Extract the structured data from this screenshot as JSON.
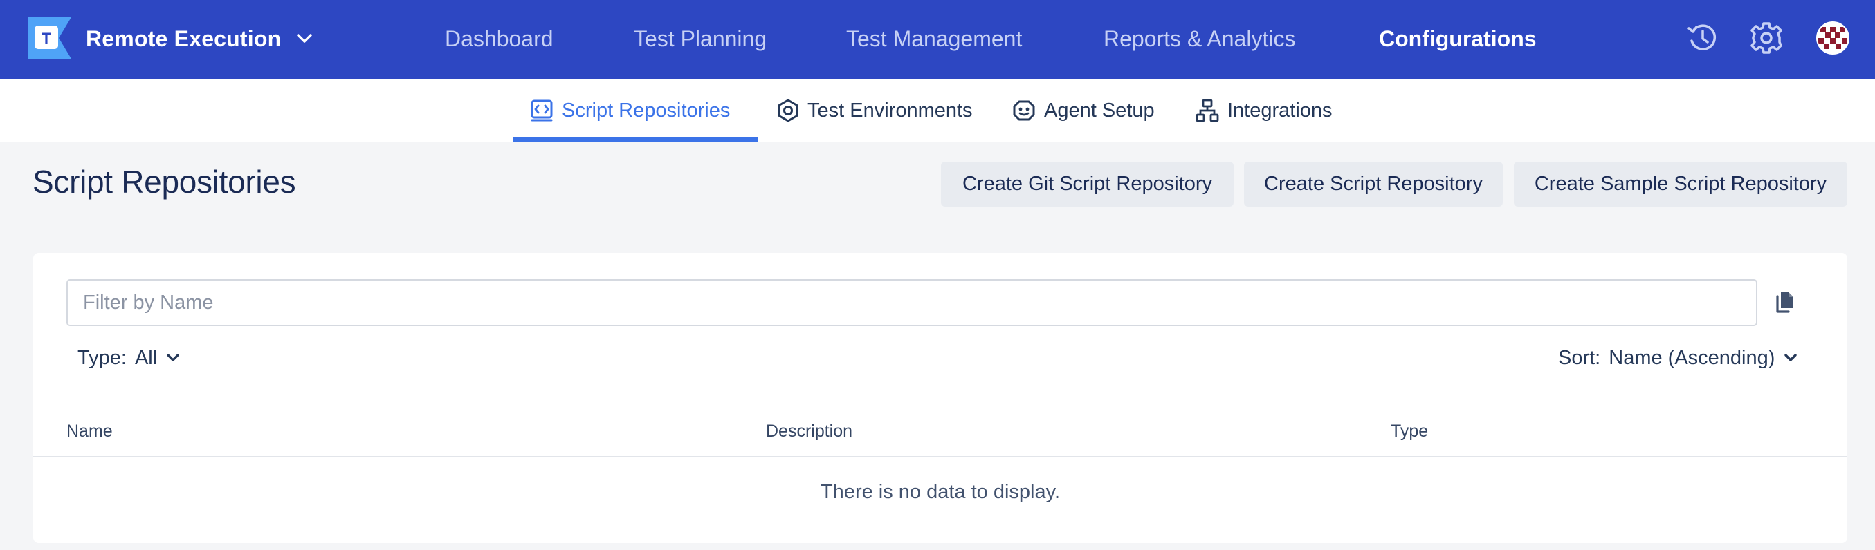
{
  "app": {
    "name": "Remote Execution",
    "logo_letter": "T"
  },
  "nav": {
    "items": [
      {
        "label": "Dashboard"
      },
      {
        "label": "Test Planning"
      },
      {
        "label": "Test Management"
      },
      {
        "label": "Reports & Analytics"
      },
      {
        "label": "Configurations",
        "active": true
      }
    ]
  },
  "header_icons": [
    "history-icon",
    "gear-icon",
    "avatar"
  ],
  "tabs": [
    {
      "label": "Script Repositories",
      "icon": "code-repository-icon",
      "active": true
    },
    {
      "label": "Test Environments",
      "icon": "hexagon-nut-icon"
    },
    {
      "label": "Agent Setup",
      "icon": "robot-agent-icon"
    },
    {
      "label": "Integrations",
      "icon": "network-hierarchy-icon"
    }
  ],
  "page": {
    "title": "Script Repositories",
    "buttons": {
      "create_git": "Create Git Script Repository",
      "create": "Create Script Repository",
      "create_sample": "Create Sample Script Repository"
    }
  },
  "filter": {
    "placeholder": "Filter by Name",
    "value": ""
  },
  "type_filter": {
    "label": "Type:",
    "value": "All"
  },
  "sort": {
    "label": "Sort:",
    "value": "Name (Ascending)"
  },
  "table": {
    "columns": [
      "Name",
      "Description",
      "Type"
    ],
    "rows": [],
    "empty_message": "There is no data to display."
  },
  "colors": {
    "topbar": "#2d47c2",
    "accent": "#3b73e8",
    "page_bg": "#f4f5f7",
    "button_bg": "#e8ebf0",
    "title": "#1b2b55"
  }
}
